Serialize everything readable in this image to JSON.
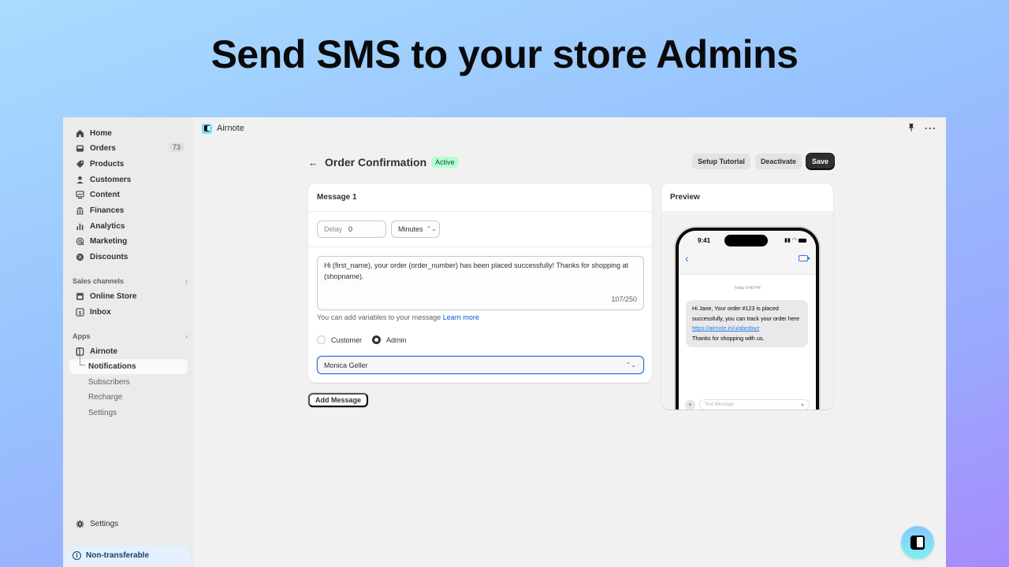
{
  "hero": {
    "title": "Send SMS to your store Admins"
  },
  "sidebar": {
    "items": [
      {
        "label": "Home",
        "icon": "home-icon"
      },
      {
        "label": "Orders",
        "icon": "orders-icon",
        "badge": "73"
      },
      {
        "label": "Products",
        "icon": "tag-icon"
      },
      {
        "label": "Customers",
        "icon": "person-icon"
      },
      {
        "label": "Content",
        "icon": "image-icon"
      },
      {
        "label": "Finances",
        "icon": "bank-icon"
      },
      {
        "label": "Analytics",
        "icon": "bar-chart-icon"
      },
      {
        "label": "Marketing",
        "icon": "target-icon"
      },
      {
        "label": "Discounts",
        "icon": "discount-icon"
      }
    ],
    "sales_channels": {
      "label": "Sales channels",
      "items": [
        {
          "label": "Online Store",
          "icon": "store-icon"
        },
        {
          "label": "Inbox",
          "icon": "inbox-icon"
        }
      ]
    },
    "apps": {
      "label": "Apps",
      "app_name": "Airnote",
      "sub_items": [
        {
          "label": "Notifications",
          "active": true
        },
        {
          "label": "Subscribers"
        },
        {
          "label": "Recharge"
        },
        {
          "label": "Settings"
        }
      ]
    },
    "settings_label": "Settings",
    "non_transferable_label": "Non-transferable"
  },
  "topbar": {
    "app_name": "Airnote",
    "pin_icon": "pin-icon",
    "more_icon": "more-horizontal-icon"
  },
  "page": {
    "title": "Order Confirmation",
    "status": "Active",
    "buttons": {
      "setup_tutorial": "Setup Tutorial",
      "deactivate": "Deactivate",
      "save": "Save"
    }
  },
  "message": {
    "title": "Message 1",
    "delay_label": "Delay",
    "delay_value": "0",
    "unit_value": "Minutes",
    "text": "Hi (first_name), your order (order_number) has been placed successfully! Thanks for shopping at (shopname).",
    "char_count": "107/250",
    "help_text": "You can add variables to your message",
    "help_link": "Learn more",
    "recipients": [
      {
        "label": "Customer",
        "checked": false
      },
      {
        "label": "Admin",
        "checked": true
      }
    ],
    "admin_selected": "Monica Geller",
    "add_message_label": "Add Message"
  },
  "preview": {
    "title": "Preview",
    "phone_time": "9:41",
    "date_label": "Today 9:40 PM",
    "sms_text_1": "Hi Jane, Your order #123 is placed successfully, you can track your order here ",
    "sms_link": "https://airnote.in/u/abcdxyz",
    "sms_text_2": "Thanks for shopping with us.",
    "compose_placeholder": "Text Message"
  },
  "colors": {
    "accent_blue": "#005bd3",
    "active_badge_bg": "#b4fed2",
    "primary_button": "#303030",
    "focus_border": "#2c6ecb"
  }
}
